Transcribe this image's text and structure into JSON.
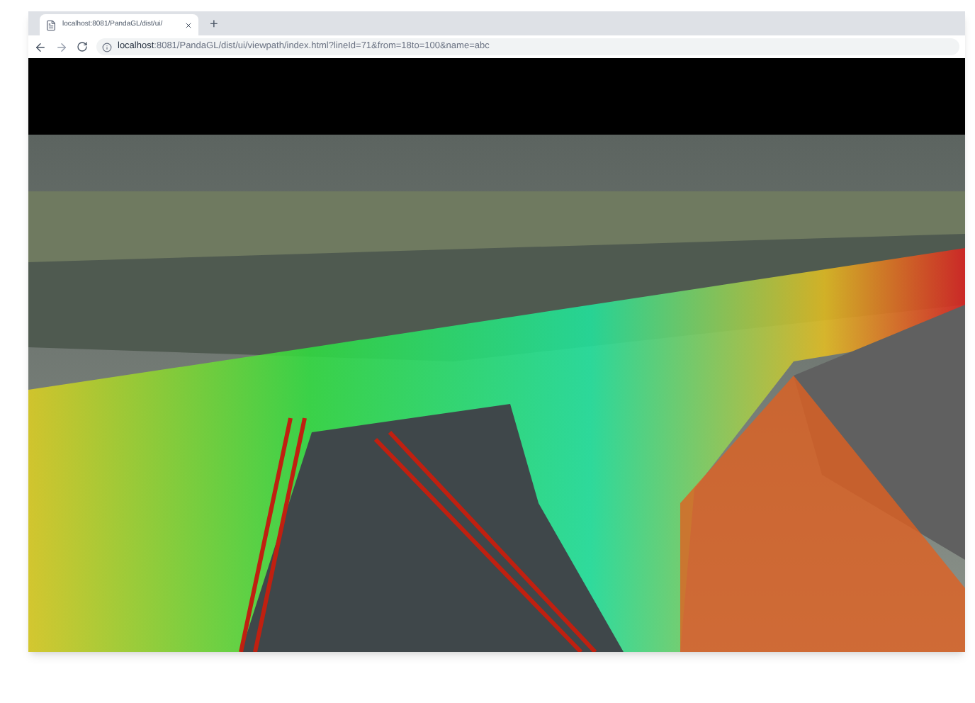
{
  "tabs": [
    {
      "title": "localhost:8081/PandaGL/dist/ui/",
      "selected": true
    }
  ],
  "new_tab": "+",
  "address_bar": {
    "host": "localhost",
    "rest": ":8081/PandaGL/dist/ui/viewpath/index.html?lineId=71&from=18to=100&name=abc"
  }
}
